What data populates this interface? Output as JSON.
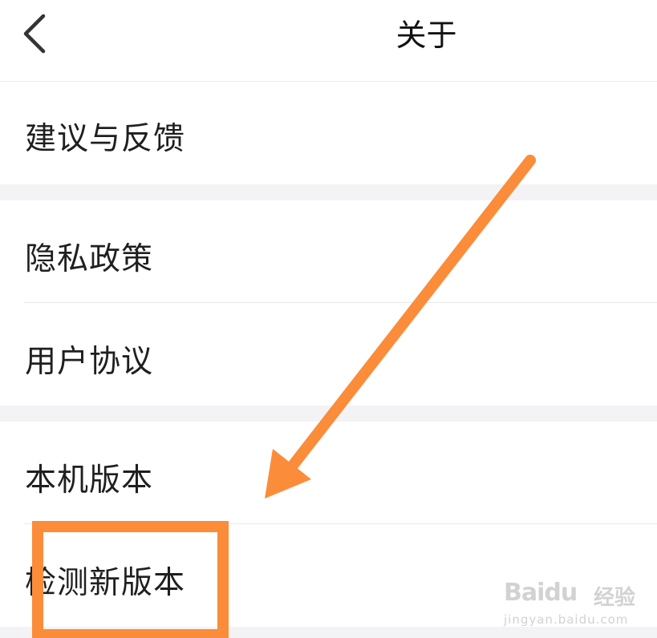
{
  "header": {
    "title": "关于",
    "back_icon": "chevron-left-icon"
  },
  "menu": {
    "items": [
      {
        "label": "建议与反馈"
      },
      {
        "label": "隐私政策"
      },
      {
        "label": "用户协议"
      },
      {
        "label": "本机版本"
      },
      {
        "label": "检测新版本"
      }
    ]
  },
  "annotation": {
    "color": "#fb8c3a"
  },
  "watermark": {
    "logo": "Baidu",
    "text": "经验",
    "url": "jingyan.baidu.com"
  }
}
